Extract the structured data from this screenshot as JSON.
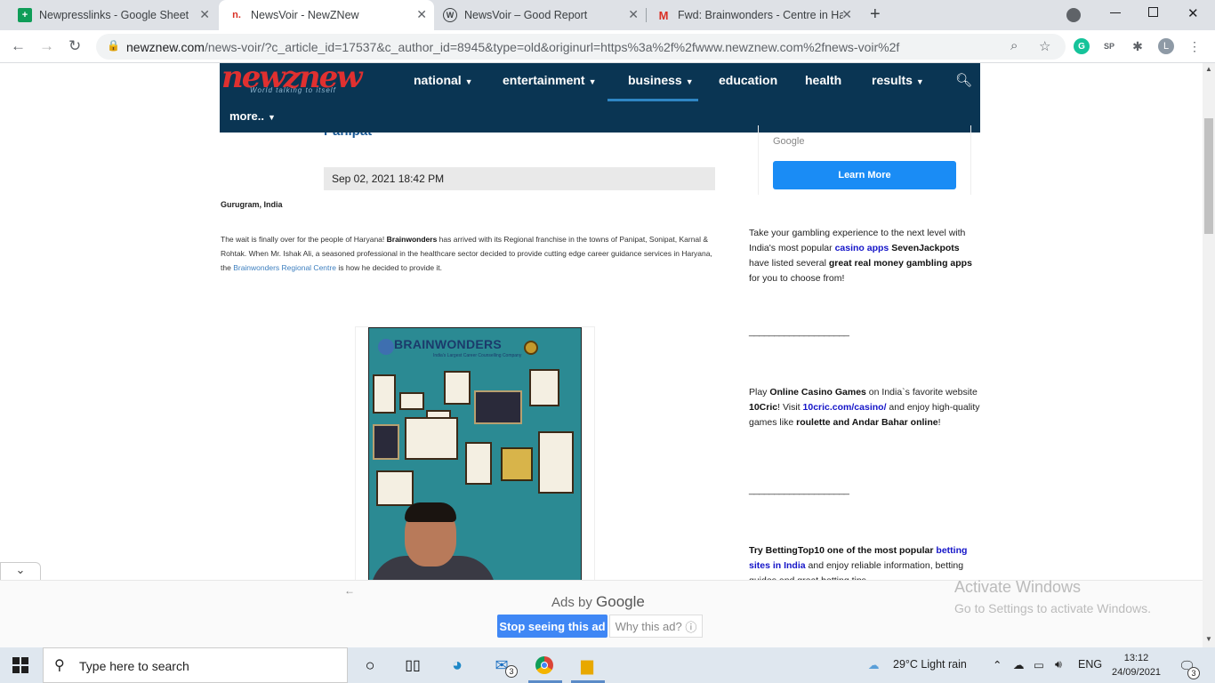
{
  "browser": {
    "tabs": [
      {
        "title": "Newpresslinks - Google Sheets",
        "favicon": "sheets-icon",
        "color": "#0f9d58",
        "glyph": "+"
      },
      {
        "title": "NewsVoir - NewZNew",
        "favicon": "newznew-icon",
        "color": "#d93025",
        "glyph": "n."
      },
      {
        "title": "NewsVoir – Good Report",
        "favicon": "wordpress-icon",
        "color": "#3c4043",
        "glyph": "W"
      },
      {
        "title": "Fwd: Brainwonders - Centre in Ha",
        "favicon": "gmail-icon",
        "color": "#d93025",
        "glyph": "M"
      }
    ],
    "close_glyph": "✕",
    "new_tab_glyph": "+",
    "url_host": "newznew.com",
    "url_path": "/news-voir/?c_article_id=17537&c_author_id=8945&type=old&originurl=https%3a%2f%2fwww.newznew.com%2fnews-voir%2f",
    "profile_initial": "L",
    "ext_sp": "SP"
  },
  "site": {
    "logo_text": "newznew",
    "logo_tagline": "World talking to itself",
    "nav": [
      {
        "label": "national",
        "has_menu": true
      },
      {
        "label": "entertainment",
        "has_menu": true
      },
      {
        "label": "business",
        "has_menu": true,
        "active": true
      },
      {
        "label": "education",
        "has_menu": false
      },
      {
        "label": "health",
        "has_menu": false
      },
      {
        "label": "results",
        "has_menu": true
      },
      {
        "label": "more..",
        "has_menu": true
      }
    ],
    "nav_bg": "#0a3553",
    "accent": "#2f86c4"
  },
  "article": {
    "headline_fragment": "Panipat",
    "date": "Sep 02, 2021 18:42 PM",
    "dateline": "Gurugram, India",
    "p1_a": "The wait is finally over for the people of Haryana! ",
    "p1_brand": "Brainwonders",
    "p1_b": " has arrived with its Regional franchise in the towns of Panipat, Sonipat, Karnal & Rohtak. When Mr. Ishak Ali, a seasoned professional in the healthcare sector decided to provide cutting edge career guidance services in Haryana, the ",
    "p1_link": "Brainwonders Regional Centre",
    "p1_c": " is how he decided to provide it.",
    "image_logo": "BRAINWONDERS",
    "image_sub": "India's Largest Career Counselling Company"
  },
  "sidebar": {
    "ad_google": "Google",
    "ad_button": "Learn More",
    "block1": {
      "t1": "Take your gambling experience to the next level with India's most popular ",
      "l1": "casino apps",
      "t2": " ",
      "b1": "SevenJackpots",
      "t3": " have listed several ",
      "b2": "great real money gambling apps",
      "t4": " for you to choose from!"
    },
    "divider": "____________________",
    "block2": {
      "t1": "Play ",
      "b1": "Online Casino Games",
      "t2": " on India`s favorite website ",
      "b2": "10Cric",
      "t3": "! Visit ",
      "l1": "10cric.com/casino/",
      "t4": " and enjoy high-quality games like ",
      "b3": "roulette and Andar Bahar online",
      "t5": "!"
    },
    "block3": {
      "b1": "Try BettingTop10 one of the most popular ",
      "l1": "betting sites in India",
      "t1": " and enjoy reliable information, betting guides and great betting tips"
    }
  },
  "adbar": {
    "ads_by": "Ads by",
    "google": "Google",
    "stop": "Stop seeing this ad",
    "why": "Why this ad?",
    "why_icon": "ⓘ"
  },
  "watermark": {
    "line1": "Activate Windows",
    "line2": "Go to Settings to activate Windows."
  },
  "taskbar": {
    "search_placeholder": "Type here to search",
    "weather": "29°C  Light rain",
    "lang": "ENG",
    "time": "13:12",
    "date": "24/09/2021",
    "mail_badge": "3",
    "notif_badge": "3"
  }
}
